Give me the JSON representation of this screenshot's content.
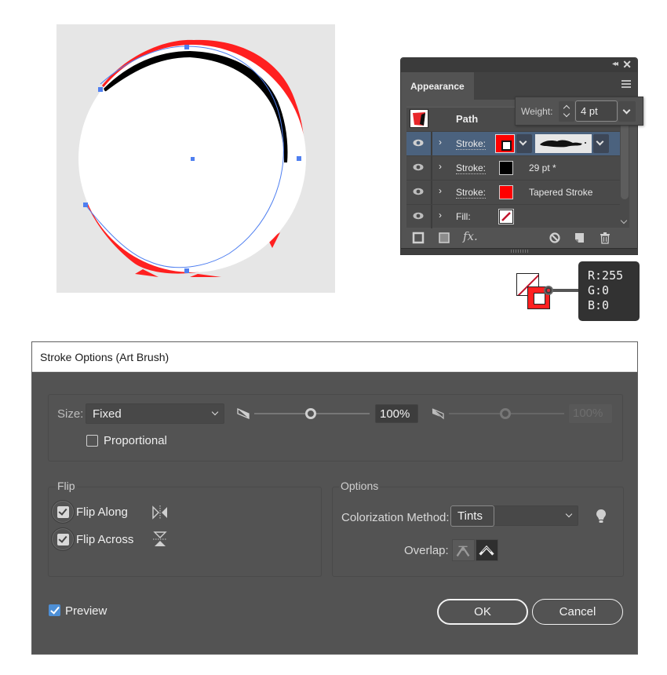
{
  "artboard": {
    "stroke_color": "#ff2020",
    "inner_stroke_color": "#000000",
    "fill_color": "#ffffff",
    "selection_color": "#4f7ff0"
  },
  "appearance_panel": {
    "tab_label": "Appearance",
    "object_label": "Path",
    "rows": [
      {
        "label": "Stroke:",
        "swatch": "#ff0000",
        "value": "",
        "selected": true
      },
      {
        "label": "Stroke:",
        "swatch": "#000000",
        "value": "29 pt *",
        "selected": false
      },
      {
        "label": "Stroke:",
        "swatch": "#ff0000",
        "value": "Tapered Stroke",
        "selected": false
      },
      {
        "label": "Fill:",
        "swatch": "none",
        "value": "",
        "selected": false
      }
    ],
    "footer_icons": [
      "add-new-stroke-icon",
      "add-new-fill-icon",
      "fx-icon",
      "clear-appearance-icon",
      "duplicate-item-icon",
      "delete-item-icon"
    ],
    "fx_label": "fx."
  },
  "weight_popup": {
    "label": "Weight:",
    "value": "4 pt"
  },
  "color_tooltip": {
    "r": "R:255",
    "g": "G:0",
    "b": "B:0"
  },
  "dialog": {
    "title": "Stroke Options (Art Brush)",
    "size_label": "Size:",
    "size_value": "Fixed",
    "size_slider_percent": 100,
    "size_percent": "100%",
    "second_percent": "100%",
    "proportional_label": "Proportional",
    "proportional_checked": false,
    "flip_legend": "Flip",
    "flip_along_label": "Flip Along",
    "flip_along_checked": true,
    "flip_across_label": "Flip Across",
    "flip_across_checked": true,
    "options_legend": "Options",
    "colorization_label": "Colorization Method:",
    "colorization_value": "Tints",
    "overlap_label": "Overlap:",
    "preview_label": "Preview",
    "preview_checked": true,
    "ok_label": "OK",
    "cancel_label": "Cancel"
  }
}
